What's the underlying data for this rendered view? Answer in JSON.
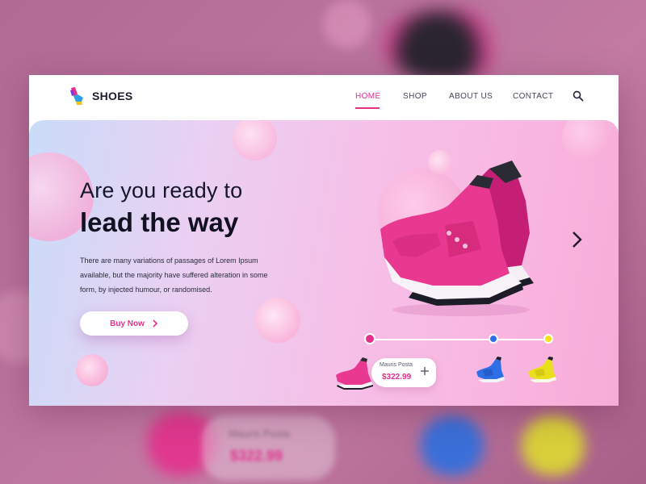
{
  "brand": {
    "name": "SHOES"
  },
  "nav": {
    "items": [
      {
        "label": "HOME",
        "active": true
      },
      {
        "label": "SHOP",
        "active": false
      },
      {
        "label": "ABOUT US",
        "active": false
      },
      {
        "label": "CONTACT",
        "active": false
      }
    ],
    "search_icon": "search-icon"
  },
  "hero": {
    "headline_line1": "Are you ready to",
    "headline_line2": "lead the way",
    "description": "There are many variations of passages of Lorem Ipsum available, but the majority have suffered alteration in some form, by injected humour, or randomised.",
    "cta_label": "Buy Now",
    "cta_icon": "chevron-right-icon",
    "next_icon": "chevron-right-icon"
  },
  "product": {
    "name": "Mauris Posta",
    "price": "$322.99",
    "add_icon": "plus-icon"
  },
  "color_options": [
    {
      "name": "pink",
      "color": "#e62e8b",
      "selected": true
    },
    {
      "name": "blue",
      "color": "#2f6fe6",
      "selected": false
    },
    {
      "name": "yellow",
      "color": "#f4e01b",
      "selected": false
    }
  ],
  "colors": {
    "accent": "#e62e8b",
    "text_dark": "#16162a"
  }
}
